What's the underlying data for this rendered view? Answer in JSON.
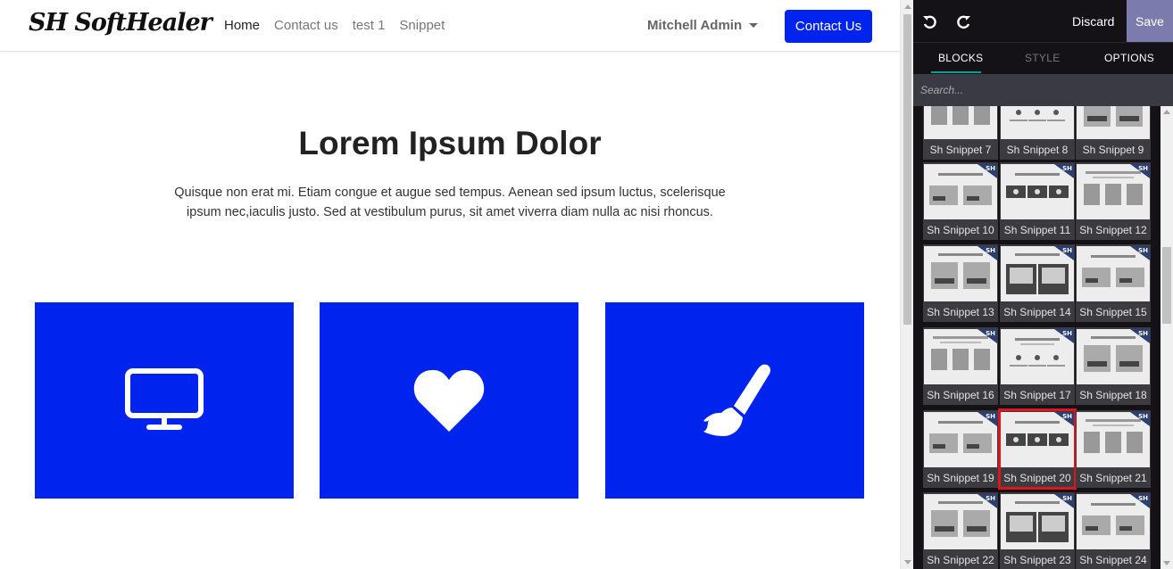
{
  "site": {
    "logo_text": "SH SoftHealer",
    "nav": [
      {
        "label": "Home",
        "active": true
      },
      {
        "label": "Contact us",
        "active": false
      },
      {
        "label": "test 1",
        "active": false
      },
      {
        "label": "Snippet",
        "active": false
      }
    ],
    "user_name": "Mitchell Admin",
    "contact_button": "Contact Us",
    "hero_title": "Lorem Ipsum Dolor",
    "hero_text": "Quisque non erat mi. Etiam congue et augue sed tempus. Aenean sed ipsum luctus, scelerisque ipsum nec,iaculis justo. Sed at vestibulum purus, sit amet viverra diam nulla ac nisi rhoncus.",
    "cards": [
      {
        "icon": "monitor-icon"
      },
      {
        "icon": "heart-icon"
      },
      {
        "icon": "paintbrush-icon"
      }
    ],
    "accent_color": "#0024ed"
  },
  "editor": {
    "discard_label": "Discard",
    "save_label": "Save",
    "tabs": [
      {
        "label": "BLOCKS",
        "active": true
      },
      {
        "label": "STYLE",
        "active": false
      },
      {
        "label": "OPTIONS",
        "active": false
      }
    ],
    "search_placeholder": "Search...",
    "badge_text": "SH",
    "snippets": [
      {
        "label": "Sh Snippet 7"
      },
      {
        "label": "Sh Snippet 8"
      },
      {
        "label": "Sh Snippet 9"
      },
      {
        "label": "Sh Snippet 10"
      },
      {
        "label": "Sh Snippet 11"
      },
      {
        "label": "Sh Snippet 12"
      },
      {
        "label": "Sh Snippet 13"
      },
      {
        "label": "Sh Snippet 14"
      },
      {
        "label": "Sh Snippet 15"
      },
      {
        "label": "Sh Snippet 16"
      },
      {
        "label": "Sh Snippet 17"
      },
      {
        "label": "Sh Snippet 18"
      },
      {
        "label": "Sh Snippet 19"
      },
      {
        "label": "Sh Snippet 20",
        "selected": true
      },
      {
        "label": "Sh Snippet 21"
      },
      {
        "label": "Sh Snippet 22"
      },
      {
        "label": "Sh Snippet 23"
      },
      {
        "label": "Sh Snippet 24"
      }
    ],
    "save_color": "#7c7bad",
    "highlight_color": "#e0141b"
  }
}
